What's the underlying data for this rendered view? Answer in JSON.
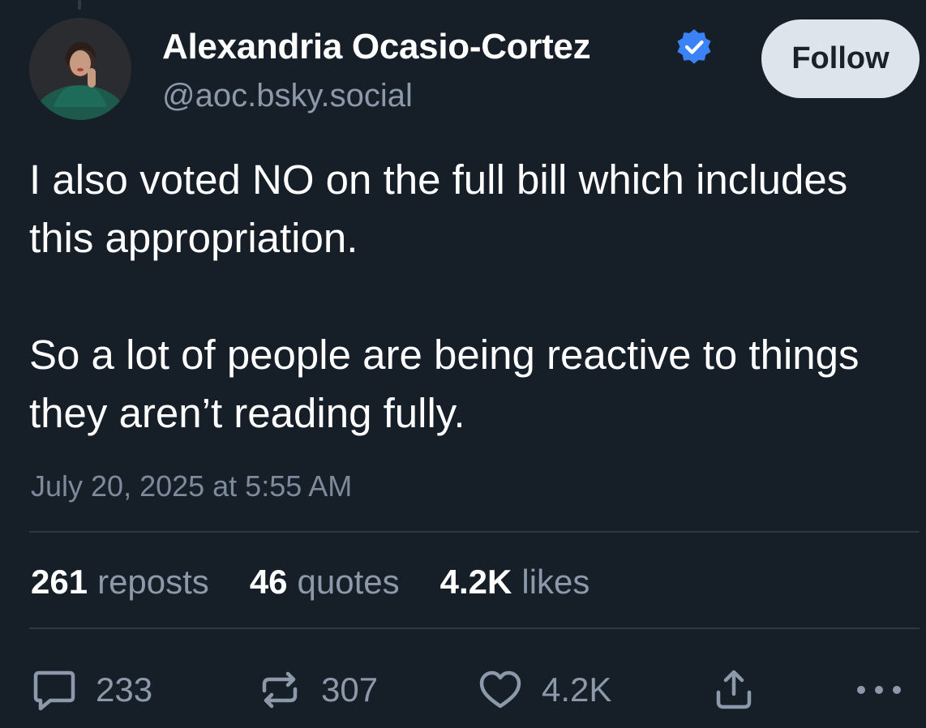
{
  "author": {
    "name": "Alexandria Ocasio-Cortez",
    "handle": "@aoc.bsky.social",
    "verified": true
  },
  "follow_label": "Follow",
  "post": {
    "paragraphs": [
      "I also voted NO on the full bill which includes this appropriation.",
      "So a lot of people are being reactive to things they aren’t reading fully."
    ],
    "timestamp": "July 20, 2025 at 5:55 AM"
  },
  "stats": {
    "reposts_count": "261",
    "reposts_label": "reposts",
    "quotes_count": "46",
    "quotes_label": "quotes",
    "likes_count": "4.2K",
    "likes_label": "likes"
  },
  "actions": {
    "reply_count": "233",
    "repost_count": "307",
    "like_count": "4.2K"
  },
  "icons": {
    "verified": "verified-check-icon",
    "reply": "speech-bubble-icon",
    "repost": "repost-arrows-icon",
    "like": "heart-icon",
    "share": "share-upload-icon",
    "more": "ellipsis-icon"
  },
  "colors": {
    "background": "#161e27",
    "verified": "#3b82f6",
    "muted_text": "#8b99aa",
    "follow_button_bg": "#dde4ec"
  }
}
